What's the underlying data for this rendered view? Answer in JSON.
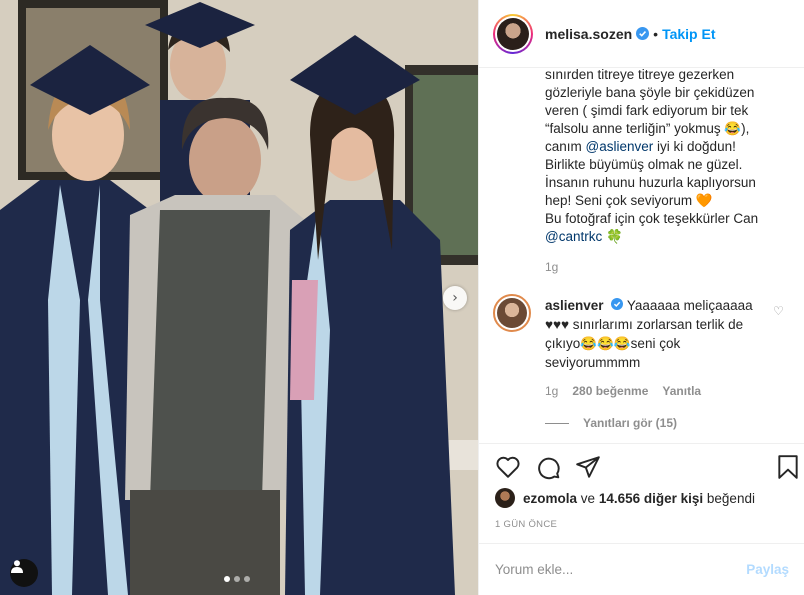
{
  "post": {
    "username": "melisa.sozen",
    "follow_label": "Takip Et",
    "separator": "•",
    "caption_lines": [
      "sınırden titreye titreye gezerken",
      "gözleriyle bana şöyle bir çekidüzen",
      "veren ( şimdi fark ediyorum bir tek",
      "“falsolu anne terliğin” yokmuş 😂),",
      "canım",
      "@aslienver",
      "iyi ki doğdun!",
      "Birlikte büyümüş olmak ne güzel.",
      "İnsanın ruhunu huzurla kaplıyorsun",
      "hep! Seni çok seviyorum 🧡",
      "Bu fotoğraf için çok teşekkürler Can",
      "@cantrkc",
      "🍀"
    ],
    "time_ago": "1g"
  },
  "comment": {
    "username": "aslienver",
    "text_line1": "Yaaaaaa meliçaaaaa",
    "text_line2": "♥♥♥ sınırlarımı zorlarsan terlik de",
    "text_line3": "çıkıyo😂😂😂seni çok",
    "text_line4": "seviyorummmm",
    "time": "1g",
    "likes": "280 beğenme",
    "reply_label": "Yanıtla",
    "view_replies": "Yanıtları gör (15)"
  },
  "likes": {
    "first_user": "ezomola",
    "connector": "ve",
    "others": "14.656 diğer kişi",
    "suffix": "beğendi"
  },
  "date_label": "1 GÜN ÖNCE",
  "comment_box": {
    "placeholder": "Yorum ekle...",
    "post_label": "Paylaş"
  },
  "colors": {
    "accent": "#0095f6",
    "link": "#00376b",
    "muted": "#8e8e8e",
    "post_disabled": "#b3dbff"
  },
  "icons": [
    "verified-badge-icon",
    "heart-icon",
    "comment-icon",
    "share-icon",
    "bookmark-icon",
    "user-tag-icon",
    "chevron-right-icon"
  ]
}
